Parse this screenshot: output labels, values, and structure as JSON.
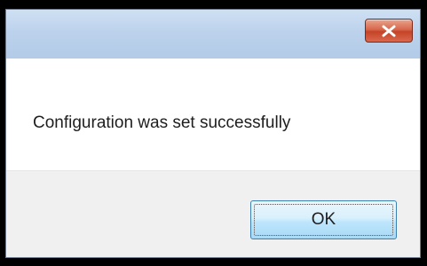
{
  "dialog": {
    "message": "Configuration was set successfully",
    "ok_label": "OK",
    "close_icon": "close-icon"
  },
  "colors": {
    "titlebar": "#bcd2ec",
    "close_button": "#c54328",
    "footer": "#f0f0f0",
    "ok_border": "#3c7fb1"
  }
}
